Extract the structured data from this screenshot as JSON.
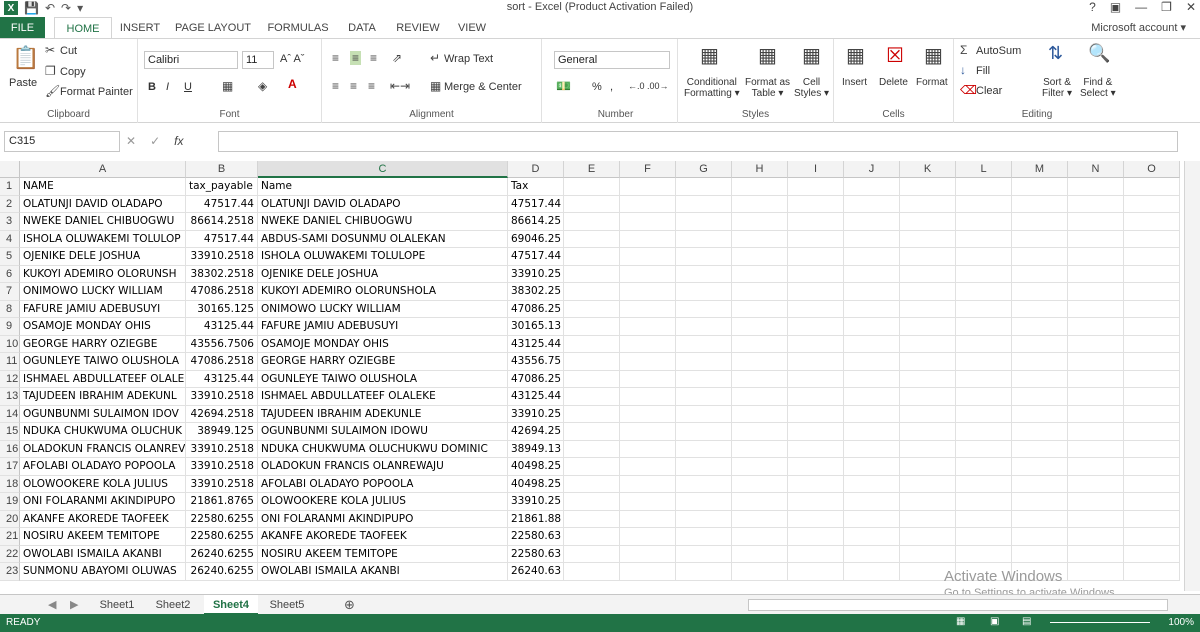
{
  "title": "sort - Excel (Product Activation Failed)",
  "tabs": [
    "FILE",
    "HOME",
    "INSERT",
    "PAGE LAYOUT",
    "FORMULAS",
    "DATA",
    "REVIEW",
    "VIEW"
  ],
  "account": "Microsoft account",
  "ribbon": {
    "clipboard": {
      "paste": "Paste",
      "cut": "Cut",
      "copy": "Copy",
      "format_painter": "Format Painter",
      "label": "Clipboard"
    },
    "font": {
      "name": "Calibri",
      "size": "11",
      "bold": "B",
      "italic": "I",
      "underline": "U",
      "label": "Font"
    },
    "alignment": {
      "wrap": "Wrap Text",
      "merge": "Merge & Center",
      "label": "Alignment"
    },
    "number": {
      "format": "General",
      "percent": "%",
      "comma": ",",
      "label": "Number"
    },
    "styles": {
      "cond1": "Conditional",
      "cond2": "Formatting",
      "fat1": "Format as",
      "fat2": "Table",
      "cell1": "Cell",
      "cell2": "Styles",
      "label": "Styles"
    },
    "cells": {
      "insert": "Insert",
      "delete": "Delete",
      "format": "Format",
      "label": "Cells"
    },
    "editing": {
      "autosum": "AutoSum",
      "fill": "Fill",
      "clear": "Clear",
      "sort1": "Sort &",
      "sort2": "Filter",
      "find1": "Find &",
      "find2": "Select",
      "label": "Editing"
    }
  },
  "name_box": "C315",
  "fx": "fx",
  "columns": [
    "A",
    "B",
    "C",
    "D",
    "E",
    "F",
    "G",
    "H",
    "I",
    "J",
    "K",
    "L",
    "M",
    "N",
    "O"
  ],
  "rows": [
    {
      "n": "1",
      "a": "NAME",
      "b": "tax_payable",
      "c": "Name",
      "d": "Tax"
    },
    {
      "n": "2",
      "a": "OLATUNJI DAVID OLADAPO",
      "b": "47517.44",
      "c": "OLATUNJI DAVID OLADAPO",
      "d": "47517.44"
    },
    {
      "n": "3",
      "a": "NWEKE DANIEL CHIBUOGWU",
      "b": "86614.2518",
      "c": "NWEKE DANIEL CHIBUOGWU",
      "d": "86614.25"
    },
    {
      "n": "4",
      "a": "ISHOLA OLUWAKEMI TOLULOP",
      "b": "47517.44",
      "c": "ABDUS-SAMI DOSUNMU OLALEKAN",
      "d": "69046.25"
    },
    {
      "n": "5",
      "a": "OJENIKE DELE JOSHUA",
      "b": "33910.2518",
      "c": "ISHOLA OLUWAKEMI TOLULOPE",
      "d": "47517.44"
    },
    {
      "n": "6",
      "a": "KUKOYI ADEMIRO OLORUNSH",
      "b": "38302.2518",
      "c": "OJENIKE DELE JOSHUA",
      "d": "33910.25"
    },
    {
      "n": "7",
      "a": "ONIMOWO LUCKY WILLIAM",
      "b": "47086.2518",
      "c": "KUKOYI ADEMIRO OLORUNSHOLA",
      "d": "38302.25"
    },
    {
      "n": "8",
      "a": "FAFURE JAMIU ADEBUSUYI",
      "b": "30165.125",
      "c": "ONIMOWO LUCKY WILLIAM",
      "d": "47086.25"
    },
    {
      "n": "9",
      "a": "OSAMOJE MONDAY OHIS",
      "b": "43125.44",
      "c": "FAFURE JAMIU ADEBUSUYI",
      "d": "30165.13"
    },
    {
      "n": "10",
      "a": "GEORGE HARRY OZIEGBE",
      "b": "43556.7506",
      "c": "OSAMOJE MONDAY OHIS",
      "d": "43125.44"
    },
    {
      "n": "11",
      "a": "OGUNLEYE TAIWO OLUSHOLA",
      "b": "47086.2518",
      "c": "GEORGE HARRY OZIEGBE",
      "d": "43556.75"
    },
    {
      "n": "12",
      "a": "ISHMAEL ABDULLATEEF OLALE",
      "b": "43125.44",
      "c": "OGUNLEYE TAIWO OLUSHOLA",
      "d": "47086.25"
    },
    {
      "n": "13",
      "a": "TAJUDEEN IBRAHIM ADEKUNL",
      "b": "33910.2518",
      "c": "ISHMAEL ABDULLATEEF OLALEKE",
      "d": "43125.44"
    },
    {
      "n": "14",
      "a": "OGUNBUNMI SULAIMON IDOV",
      "b": "42694.2518",
      "c": "TAJUDEEN IBRAHIM ADEKUNLE",
      "d": "33910.25"
    },
    {
      "n": "15",
      "a": "NDUKA CHUKWUMA OLUCHUK",
      "b": "38949.125",
      "c": "OGUNBUNMI SULAIMON IDOWU",
      "d": "42694.25"
    },
    {
      "n": "16",
      "a": "OLADOKUN FRANCIS OLANREV",
      "b": "33910.2518",
      "c": "NDUKA CHUKWUMA OLUCHUKWU DOMINIC",
      "d": "38949.13"
    },
    {
      "n": "17",
      "a": "AFOLABI OLADAYO POPOOLA",
      "b": "33910.2518",
      "c": "OLADOKUN FRANCIS OLANREWAJU",
      "d": "40498.25"
    },
    {
      "n": "18",
      "a": "OLOWOOKERE KOLA JULIUS",
      "b": "33910.2518",
      "c": "AFOLABI OLADAYO POPOOLA",
      "d": "40498.25"
    },
    {
      "n": "19",
      "a": "ONI FOLARANMI AKINDIPUPO",
      "b": "21861.8765",
      "c": "OLOWOOKERE KOLA JULIUS",
      "d": "33910.25"
    },
    {
      "n": "20",
      "a": "AKANFE AKOREDE TAOFEEK",
      "b": "22580.6255",
      "c": "ONI FOLARANMI AKINDIPUPO",
      "d": "21861.88"
    },
    {
      "n": "21",
      "a": "NOSIRU AKEEM TEMITOPE",
      "b": "22580.6255",
      "c": "AKANFE AKOREDE TAOFEEK",
      "d": "22580.63"
    },
    {
      "n": "22",
      "a": "OWOLABI ISMAILA AKANBI",
      "b": "26240.6255",
      "c": "NOSIRU AKEEM TEMITOPE",
      "d": "22580.63"
    },
    {
      "n": "23",
      "a": "SUNMONU ABAYOMI OLUWAS",
      "b": "26240.6255",
      "c": "OWOLABI ISMAILA AKANBI",
      "d": "26240.63"
    }
  ],
  "sheets": [
    "Sheet1",
    "Sheet2",
    "Sheet4",
    "Sheet5"
  ],
  "active_sheet": "Sheet4",
  "status": {
    "ready": "READY",
    "zoom": "100%"
  },
  "watermark": {
    "line1": "Activate Windows",
    "line2": "Go to Settings to activate Windows."
  },
  "colors": {
    "accent": "#217346"
  }
}
